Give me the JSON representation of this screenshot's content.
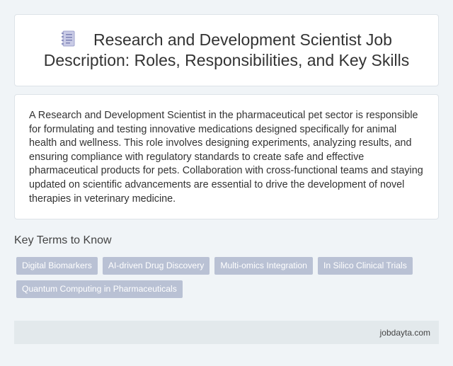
{
  "header": {
    "icon": "document-icon",
    "title": "Research and Development Scientist Job Description: Roles, Responsibilities, and Key Skills"
  },
  "description": {
    "text": "A Research and Development Scientist in the pharmaceutical pet sector is responsible for formulating and testing innovative medications designed specifically for animal health and wellness. This role involves designing experiments, analyzing results, and ensuring compliance with regulatory standards to create safe and effective pharmaceutical products for pets. Collaboration with cross-functional teams and staying updated on scientific advancements are essential to drive the development of novel therapies in veterinary medicine."
  },
  "key_terms": {
    "heading": "Key Terms to Know",
    "tags": [
      "Digital Biomarkers",
      "AI-driven Drug Discovery",
      "Multi-omics Integration",
      "In Silico Clinical Trials",
      "Quantum Computing in Pharmaceuticals"
    ]
  },
  "footer": {
    "site": "jobdayta.com"
  },
  "colors": {
    "background": "#f0f4f7",
    "card": "#ffffff",
    "tag": "#b9c1d4",
    "footer": "#e3e9ec"
  }
}
